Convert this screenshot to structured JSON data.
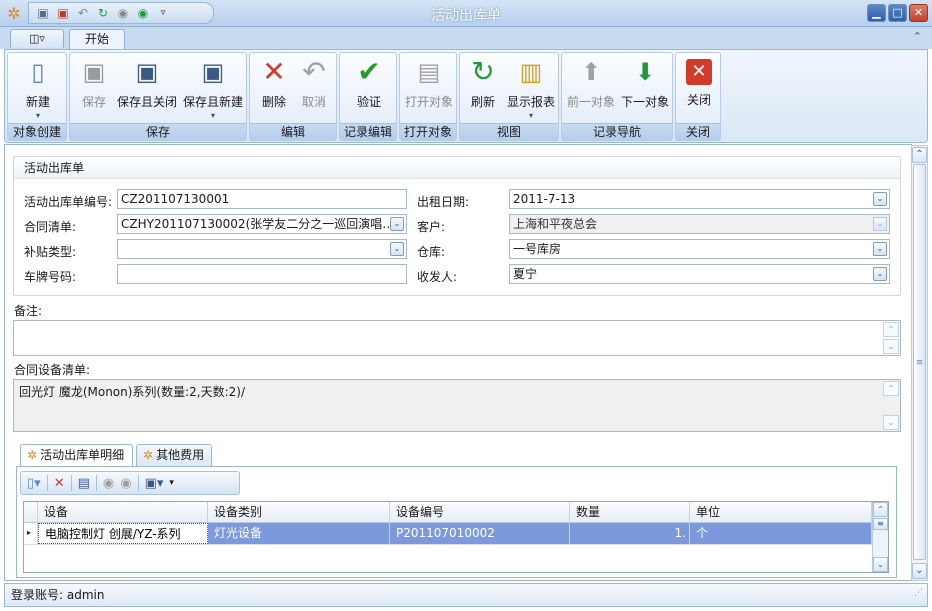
{
  "window": {
    "title": "活动出库单"
  },
  "tabs": {
    "start": "开始"
  },
  "ribbon": {
    "groups": {
      "create": "对象创建",
      "save": "保存",
      "edit": "编辑",
      "validate": "记录编辑",
      "open": "打开对象",
      "view": "视图",
      "nav": "记录导航",
      "close": "关闭"
    },
    "buttons": {
      "new": "新建",
      "save": "保存",
      "save_close": "保存且关闭",
      "save_new": "保存且新建",
      "delete": "删除",
      "cancel": "取消",
      "validate": "验证",
      "open": "打开对象",
      "refresh": "刷新",
      "report": "显示报表",
      "prev": "前一对象",
      "next": "下一对象",
      "close": "关闭"
    }
  },
  "form": {
    "section_title": "活动出库单",
    "fields": {
      "code_label": "活动出库单编号:",
      "code_value": "CZ201107130001",
      "date_label": "出租日期:",
      "date_value": "2011-7-13",
      "contract_label": "合同清单:",
      "contract_value": "CZHY201107130002(张学友二分之一巡回演唱…",
      "customer_label": "客户:",
      "customer_value": "上海和平夜总会",
      "subsidy_label": "补贴类型:",
      "subsidy_value": "",
      "warehouse_label": "仓库:",
      "warehouse_value": "一号库房",
      "plate_label": "车牌号码:",
      "plate_value": "",
      "receiver_label": "收发人:",
      "receiver_value": "夏宁"
    },
    "remark_label": "备注:",
    "remark_value": "",
    "equip_label": "合同设备清单:",
    "equip_value": "回光灯  魔龙(Monon)系列(数量:2,天数:2)/"
  },
  "detail": {
    "tabs": [
      "活动出库单明细",
      "其他费用"
    ],
    "columns": [
      "设备",
      "设备类别",
      "设备编号",
      "数量",
      "单位"
    ],
    "rows": [
      {
        "device": "电脑控制灯 创展/YZ-系列",
        "category": "灯光设备",
        "code": "P201107010002",
        "qty": "1.",
        "unit": "个"
      }
    ]
  },
  "status": {
    "login": "登录账号: admin"
  }
}
